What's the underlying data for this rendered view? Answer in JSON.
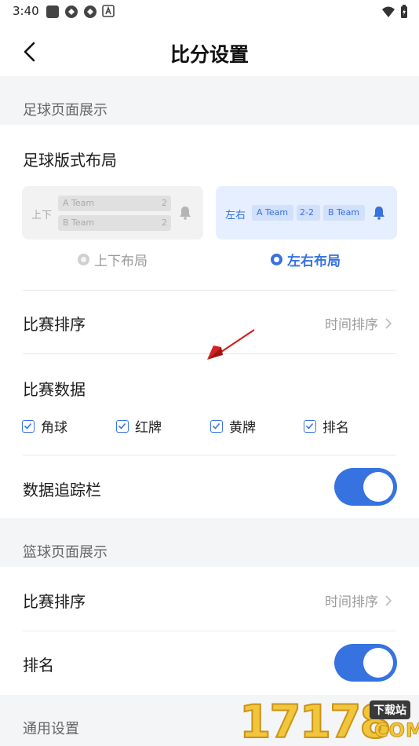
{
  "status": {
    "time": "3:40"
  },
  "nav": {
    "title": "比分设置"
  },
  "football": {
    "section_title": "足球页面展示",
    "layout_title": "足球版式布局",
    "card_a": {
      "label": "上下",
      "team_a": "A Team",
      "team_b": "B Team",
      "score_a": "2",
      "score_b": "2"
    },
    "card_b": {
      "label": "左右",
      "team_a": "A Team",
      "score": "2-2",
      "team_b": "B Team"
    },
    "option_a": "上下布局",
    "option_b": "左右布局",
    "sort_title": "比赛排序",
    "sort_value": "时间排序",
    "data_title": "比赛数据",
    "checkboxes": [
      "角球",
      "红牌",
      "黄牌",
      "排名"
    ],
    "tracker_title": "数据追踪栏"
  },
  "basketball": {
    "section_title": "篮球页面展示",
    "sort_title": "比赛排序",
    "sort_value": "时间排序",
    "rank_title": "排名"
  },
  "general": {
    "section_title": "通用设置"
  },
  "watermark": {
    "digits": "17178",
    "tag": "下载站",
    "domain": "COM"
  },
  "colors": {
    "accent": "#3672e0",
    "section_bg": "#f4f5f7",
    "muted_text": "#9b9b9b"
  }
}
